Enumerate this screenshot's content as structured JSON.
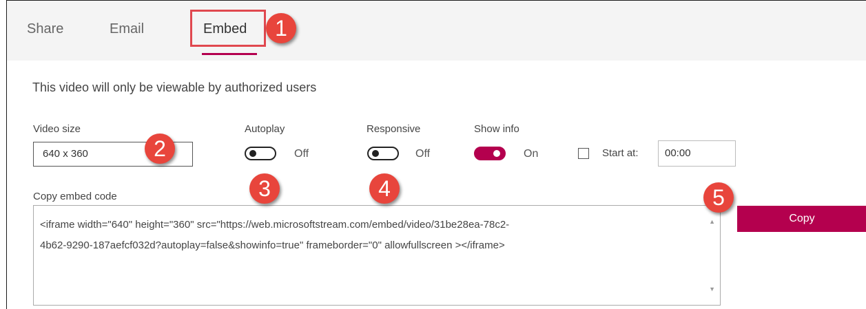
{
  "tabs": [
    {
      "label": "Share"
    },
    {
      "label": "Email"
    },
    {
      "label": "Embed"
    }
  ],
  "notice": "This video will only be viewable by authorized users",
  "video_size": {
    "label": "Video size",
    "value": "640 x 360"
  },
  "autoplay": {
    "label": "Autoplay",
    "state": "Off"
  },
  "responsive": {
    "label": "Responsive",
    "state": "Off"
  },
  "show_info": {
    "label": "Show info",
    "state": "On"
  },
  "start_at": {
    "label": "Start at:",
    "value": "00:00",
    "checked": false
  },
  "embed": {
    "label": "Copy embed code",
    "code_line1": "<iframe width=\"640\" height=\"360\" src=\"https://web.microsoftstream.com/embed/video/31be28ea-78c2-",
    "code_line2": "4b62-9290-187aefcf032d?autoplay=false&showinfo=true\" frameborder=\"0\" allowfullscreen ></iframe>"
  },
  "copy_button": "Copy",
  "annotations": [
    "1",
    "2",
    "3",
    "4",
    "5"
  ],
  "colors": {
    "accent": "#b4004e",
    "badge": "#e8453c",
    "highlight": "#e0484f"
  }
}
